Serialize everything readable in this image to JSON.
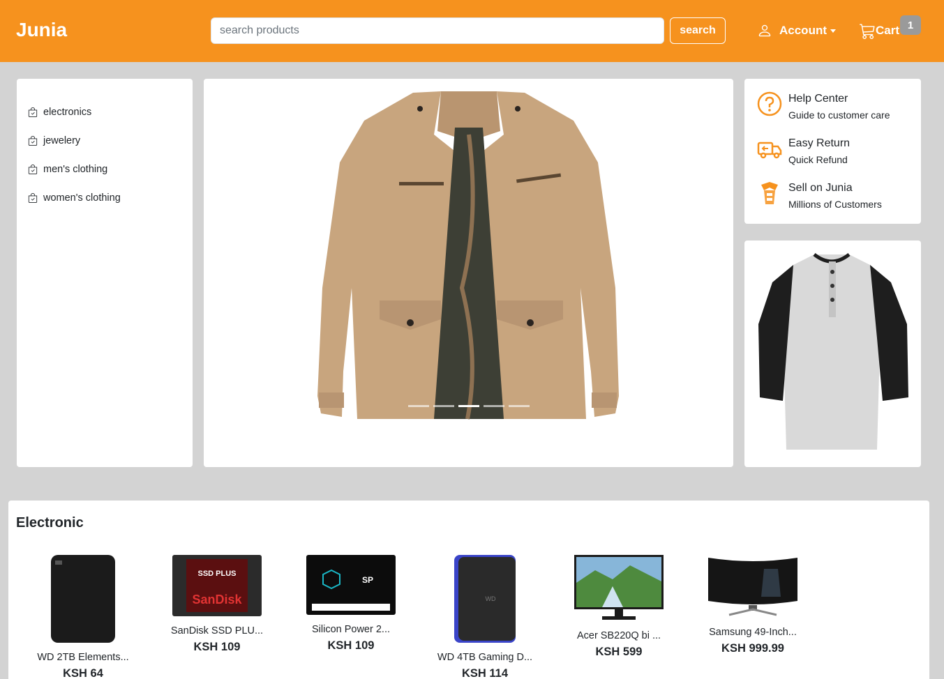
{
  "header": {
    "brand": "Junia",
    "search_placeholder": "search products",
    "search_label": "search",
    "account_label": "Account",
    "cart_label": "Cart",
    "cart_count": "1",
    "accent_color": "#f6921e"
  },
  "categories": [
    {
      "label": "electronics",
      "icon": "bag-check-icon"
    },
    {
      "label": "jewelery",
      "icon": "bag-check-icon"
    },
    {
      "label": "men's clothing",
      "icon": "bag-check-icon"
    },
    {
      "label": "women's clothing",
      "icon": "bag-check-icon"
    }
  ],
  "carousel": {
    "slide_count": 5,
    "active_index": 2
  },
  "info": [
    {
      "title": "Help Center",
      "subtitle": "Guide to customer care",
      "icon": "help-circle-icon"
    },
    {
      "title": "Easy Return",
      "subtitle": "Quick Refund",
      "icon": "return-truck-icon"
    },
    {
      "title": "Sell on Junia",
      "subtitle": "Millions of Customers",
      "icon": "sell-icon"
    }
  ],
  "section": {
    "title": "Electronic",
    "products": [
      {
        "name": "WD 2TB Elements...",
        "price": "KSH 64",
        "image": "external-hard-drive"
      },
      {
        "name": "SanDisk SSD PLU...",
        "price": "KSH 109",
        "image": "ssd-drive"
      },
      {
        "name": "Silicon Power 2...",
        "price": "KSH 109",
        "image": "ssd-drive"
      },
      {
        "name": "WD 4TB Gaming D...",
        "price": "KSH 114",
        "image": "external-hard-drive"
      },
      {
        "name": "Acer SB220Q bi ...",
        "price": "KSH 599",
        "image": "monitor"
      },
      {
        "name": "Samsung 49-Inch...",
        "price": "KSH 999.99",
        "image": "curved-monitor"
      }
    ]
  }
}
